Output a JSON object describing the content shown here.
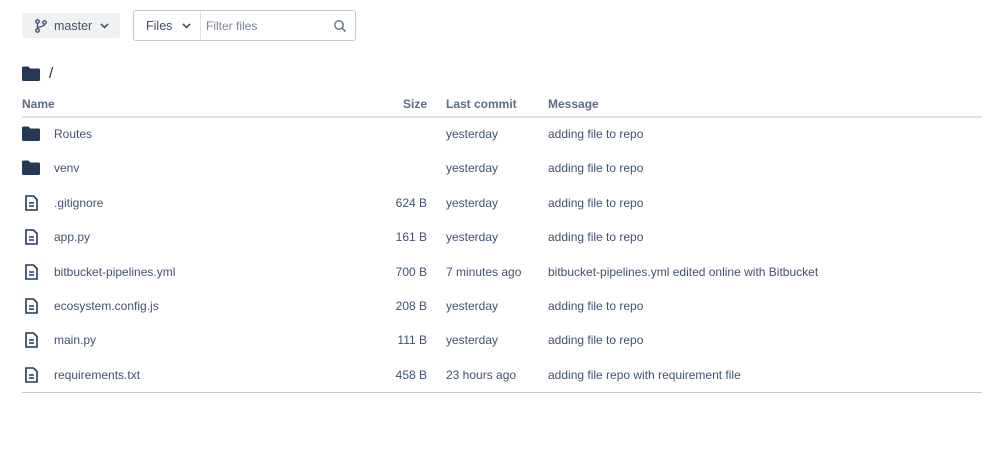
{
  "branch": {
    "label": "master"
  },
  "filter": {
    "type_label": "Files",
    "placeholder": "Filter files"
  },
  "path": {
    "separator": "/"
  },
  "table": {
    "headers": {
      "name": "Name",
      "size": "Size",
      "last_commit": "Last commit",
      "message": "Message"
    },
    "rows": [
      {
        "type": "folder",
        "name": "Routes",
        "size": "",
        "last_commit": "yesterday",
        "message": "adding file to repo"
      },
      {
        "type": "folder",
        "name": "venv",
        "size": "",
        "last_commit": "yesterday",
        "message": "adding file to repo"
      },
      {
        "type": "file",
        "name": ".gitignore",
        "size": "624 B",
        "last_commit": "yesterday",
        "message": "adding file to repo"
      },
      {
        "type": "file",
        "name": "app.py",
        "size": "161 B",
        "last_commit": "yesterday",
        "message": "adding file to repo"
      },
      {
        "type": "file",
        "name": "bitbucket-pipelines.yml",
        "size": "700 B",
        "last_commit": "7 minutes ago",
        "message": "bitbucket-pipelines.yml edited online with Bitbucket"
      },
      {
        "type": "file",
        "name": "ecosystem.config.js",
        "size": "208 B",
        "last_commit": "yesterday",
        "message": "adding file to repo"
      },
      {
        "type": "file",
        "name": "main.py",
        "size": "111 B",
        "last_commit": "yesterday",
        "message": "adding file to repo"
      },
      {
        "type": "file",
        "name": "requirements.txt",
        "size": "458 B",
        "last_commit": "23 hours ago",
        "message": "adding file repo with requirement file"
      }
    ]
  },
  "icons": {
    "branch": "branch-icon",
    "chevron": "chevron-down-icon",
    "search": "search-icon",
    "folder": "folder-icon",
    "file": "file-icon"
  },
  "colors": {
    "text": "#172b4d",
    "muted": "#42526e",
    "header": "#5e6c84",
    "folder": "#253858"
  }
}
